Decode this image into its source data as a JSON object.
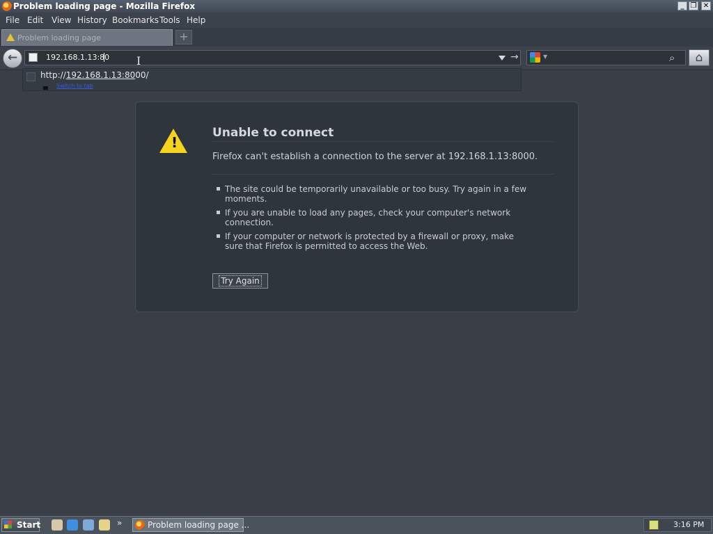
{
  "window": {
    "title": "Problem loading page - Mozilla Firefox",
    "controls": {
      "minimize": "_",
      "restore": "❐",
      "close": "✕"
    }
  },
  "menu": {
    "items": [
      "File",
      "Edit",
      "View",
      "History",
      "Bookmarks",
      "Tools",
      "Help"
    ]
  },
  "tabs": [
    {
      "label": "Problem loading page",
      "icon": "warning-icon"
    }
  ],
  "newtab": {
    "label": "+"
  },
  "nav": {
    "back_glyph": "←",
    "url": "192.168.1.13:80",
    "go_glyph": "→",
    "search_icon_glyph": "⌕",
    "home_glyph": "⌂"
  },
  "autocomplete": {
    "prefix": "http://",
    "match": "192.168.1.13:80",
    "rest": "00/",
    "action": "Switch to tab"
  },
  "error": {
    "title": "Unable to connect",
    "message": "Firefox can't establish a connection to the server at 192.168.1.13:8000.",
    "bullets": [
      "The site could be temporarily unavailable or too busy. Try again in a few moments.",
      "If you are unable to load any pages, check your computer's network connection.",
      "If your computer or network is protected by a firewall or proxy, make sure that Firefox is permitted to access the Web."
    ],
    "button": "Try Again",
    "warning_glyph": "!"
  },
  "taskbar": {
    "start": "Start",
    "chevron": "»",
    "window_label": "Problem loading page ...",
    "clock": "3:16 PM"
  },
  "colors": {
    "background": "#3a3f47",
    "panel": "#2f353d",
    "warning": "#f6d31e",
    "link": "#2f5fe0"
  }
}
